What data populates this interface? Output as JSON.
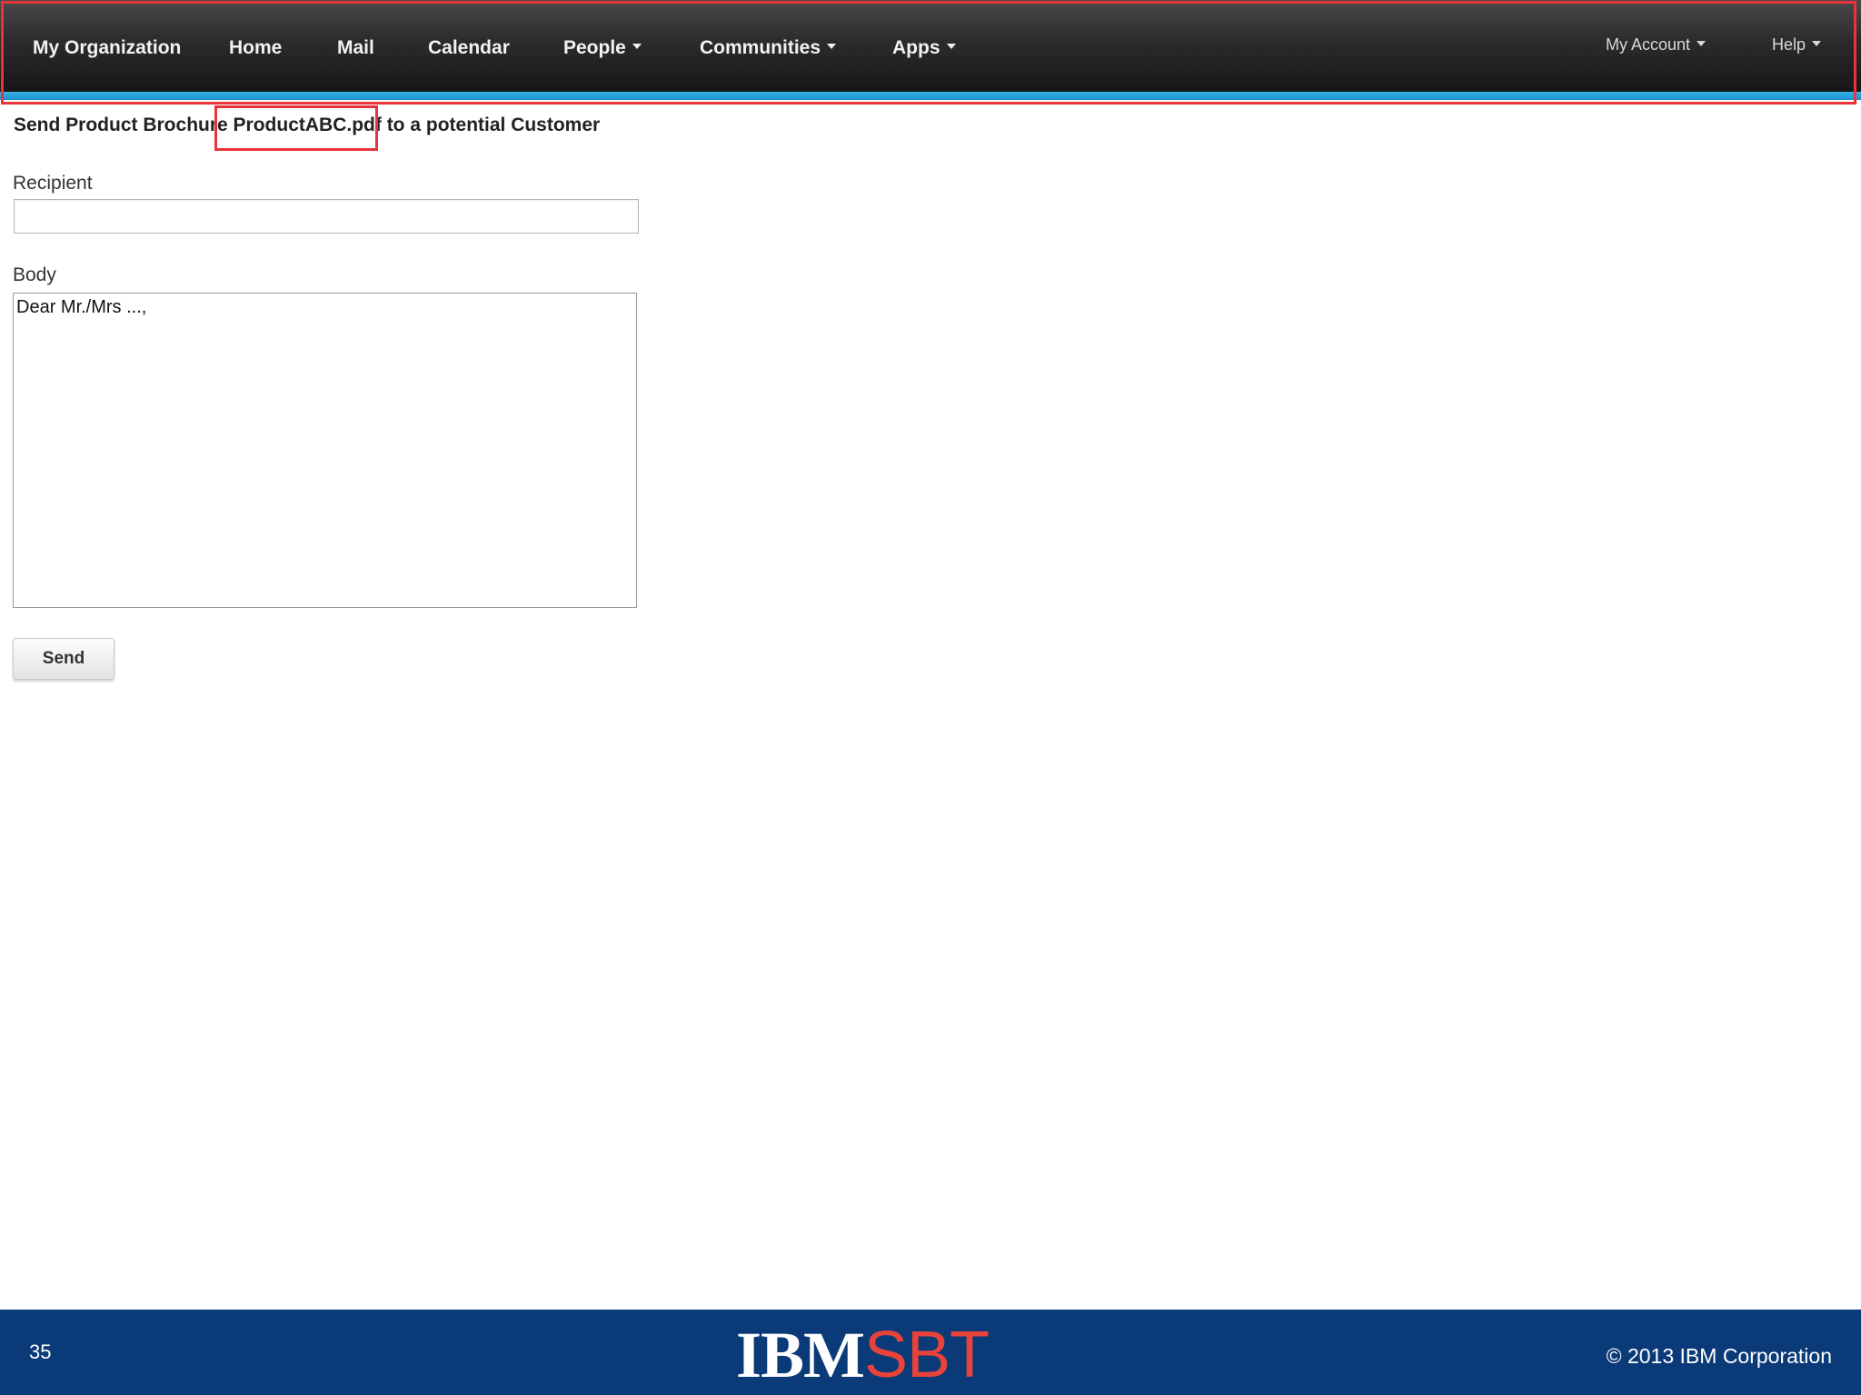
{
  "nav": {
    "items": [
      {
        "label": "My Organization",
        "dropdown": false
      },
      {
        "label": "Home",
        "dropdown": false
      },
      {
        "label": "Mail",
        "dropdown": false
      },
      {
        "label": "Calendar",
        "dropdown": false
      },
      {
        "label": "People",
        "dropdown": true
      },
      {
        "label": "Communities",
        "dropdown": true
      },
      {
        "label": "Apps",
        "dropdown": true
      }
    ],
    "right_items": [
      {
        "label": "My Account",
        "dropdown": true
      },
      {
        "label": "Help",
        "dropdown": true
      }
    ]
  },
  "form": {
    "title_prefix": "Send Product Brochure ",
    "title_file": "ProductABC.pdf",
    "title_suffix": " to a potential Customer",
    "recipient_label": "Recipient",
    "recipient_value": "",
    "body_label": "Body",
    "body_value": "Dear Mr./Mrs ...,",
    "send_label": "Send"
  },
  "footer": {
    "page_number": "35",
    "logo_ibm": "IBM",
    "logo_sbt": "SBT",
    "copyright": "© 2013 IBM Corporation"
  },
  "colors": {
    "highlight": "#e8323c",
    "nav_stripe": "#1a8fcf",
    "footer_bg": "#0b3a78",
    "logo_accent": "#e8433a"
  }
}
